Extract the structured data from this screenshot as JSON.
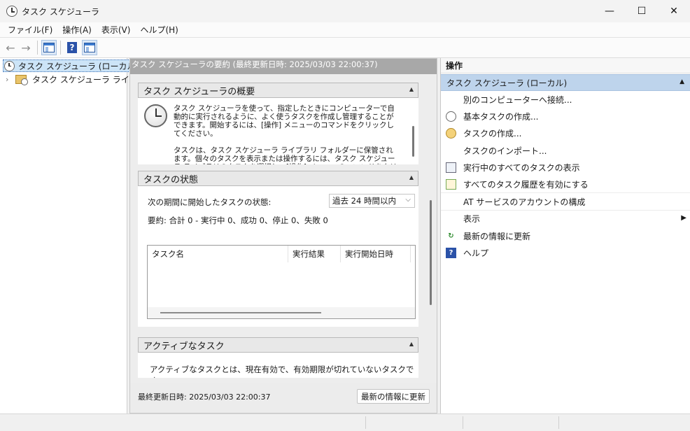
{
  "window": {
    "title": "タスク スケジューラ",
    "controls": {
      "minimize": "—",
      "maximize": "☐",
      "close": "✕"
    }
  },
  "menu": [
    "ファイル(F)",
    "操作(A)",
    "表示(V)",
    "ヘルプ(H)"
  ],
  "toolbar": {
    "back_icon": "←",
    "forward_icon": "→",
    "help_icon": "?"
  },
  "tree": {
    "root": "タスク スケジューラ (ローカル)",
    "child": "タスク スケジューラ ライブラリ",
    "expand_icon": "›"
  },
  "middle": {
    "header": "タスク スケジューラの要約 (最終更新日時: 2025/03/03 22:00:37)",
    "overview": {
      "title": "タスク スケジューラの概要",
      "paragraph1": "タスク スケジューラを使って、指定したときにコンピューターで自動的に実行されるように、よく使うタスクを作成し管理することができます。開始するには、[操作] メニューのコマンドをクリックしてください。",
      "paragraph2": "タスクは、タスク スケジューラ ライブラリ フォルダーに保管されます。個々のタスクを表示または操作するには、タスク スケジューラ ライブラリのタスクを選択し、[操作] メニューのコマンドをクリックしてください。"
    },
    "status": {
      "title": "タスクの状態",
      "period_label": "次の期間に開始したタスクの状態:",
      "period_value": "過去 24 時間以内",
      "summary": "要約: 合計 0 - 実行中 0、成功 0、停止 0、失敗 0",
      "columns": [
        "タスク名",
        "実行結果",
        "実行開始日時"
      ]
    },
    "active": {
      "title": "アクティブなタスク",
      "description": "アクティブなタスクとは、現在有効で、有効期限が切れていないタスクです。"
    },
    "footer": {
      "last_updated": "最終更新日時: 2025/03/03 22:00:37",
      "refresh_button": "最新の情報に更新"
    },
    "collapse_icon": "▲"
  },
  "actions": {
    "title": "操作",
    "group": "タスク スケジューラ (ローカル)",
    "items": [
      {
        "label": "別のコンピューターへ接続...",
        "icon": ""
      },
      {
        "label": "基本タスクの作成...",
        "icon": "clock-icon"
      },
      {
        "label": "タスクの作成...",
        "icon": "create-task-icon"
      },
      {
        "label": "タスクのインポート...",
        "icon": ""
      },
      {
        "label": "実行中のすべてのタスクの表示",
        "icon": "running-tasks-icon"
      },
      {
        "label": "すべてのタスク履歴を有効にする",
        "icon": "history-icon"
      },
      {
        "label": "AT サービスのアカウントの構成",
        "icon": ""
      },
      {
        "label": "表示",
        "icon": "",
        "submenu_icon": "▶"
      },
      {
        "label": "最新の情報に更新",
        "icon": "refresh-icon",
        "glyph": "↻"
      },
      {
        "label": "ヘルプ",
        "icon": "help-icon",
        "glyph": "?"
      }
    ]
  }
}
